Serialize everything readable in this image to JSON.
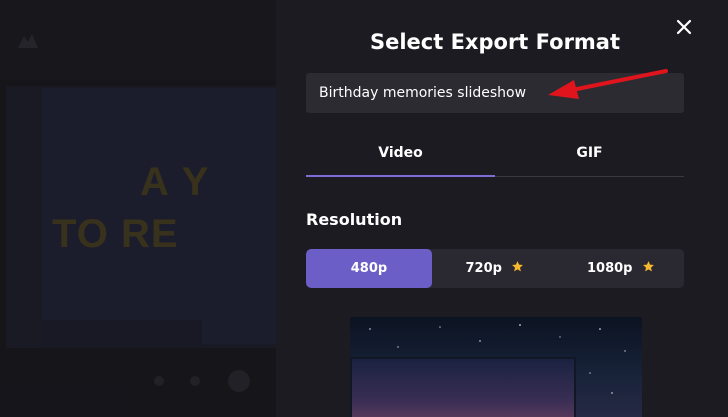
{
  "background": {
    "slide_line1": "A Y",
    "slide_line2": "TO RE"
  },
  "modal": {
    "title": "Select Export Format",
    "project_name": "Birthday memories slideshow",
    "tabs": [
      {
        "label": "Video",
        "selected": true
      },
      {
        "label": "GIF",
        "selected": false
      }
    ],
    "resolution": {
      "title": "Resolution",
      "options": [
        {
          "label": "480p",
          "selected": true,
          "premium": false
        },
        {
          "label": "720p",
          "selected": false,
          "premium": true
        },
        {
          "label": "1080p",
          "selected": false,
          "premium": true
        }
      ]
    }
  },
  "colors": {
    "accent": "#6b5fc7",
    "tab_underline": "#7b6fd6",
    "star": "#f5b82e",
    "annotation_arrow": "#e0141c"
  },
  "icons": {
    "close": "close-icon",
    "premium": "star-icon"
  }
}
